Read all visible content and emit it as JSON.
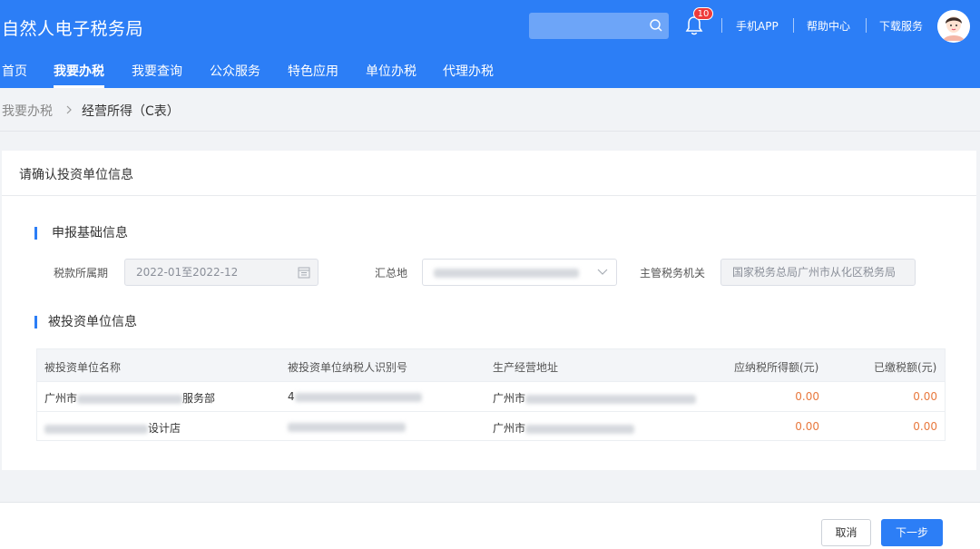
{
  "header": {
    "title": "自然人电子税务局",
    "search": {
      "placeholder": ""
    },
    "notifications_count": "10",
    "links": [
      "手机APP",
      "帮助中心",
      "下载服务"
    ]
  },
  "nav": [
    "首页",
    "我要办税",
    "我要查询",
    "公众服务",
    "特色应用",
    "单位办税",
    "代理办税"
  ],
  "breadcrumb": {
    "parent": "我要办税",
    "current": "经营所得（C表）"
  },
  "card": {
    "title": "请确认投资单位信息",
    "section1": "申报基础信息",
    "period_label": "税款所属期",
    "period_value": "2022-01至2022-12",
    "summary_label": "汇总地",
    "authority_label": "主管税务机关",
    "authority_value": "国家税务总局广州市从化区税务局",
    "section2": "被投资单位信息"
  },
  "table": {
    "headers": [
      "被投资单位名称",
      "被投资单位纳税人识别号",
      "生产经营地址",
      "应纳税所得额(元)",
      "已缴税额(元)"
    ],
    "rows": [
      {
        "name_prefix": "广州市",
        "name_suffix": "服务部",
        "taxid_prefix": "4",
        "address_prefix": "广州市",
        "taxable": "0.00",
        "paid": "0.00"
      },
      {
        "name_prefix": "",
        "name_suffix": "设计店",
        "taxid_prefix": "",
        "address_prefix": "广州市",
        "taxable": "0.00",
        "paid": "0.00"
      }
    ]
  },
  "footer": {
    "cancel": "取消",
    "next": "下一步"
  },
  "colors": {
    "primary": "#2c7ef6",
    "money": "#e8793e"
  }
}
